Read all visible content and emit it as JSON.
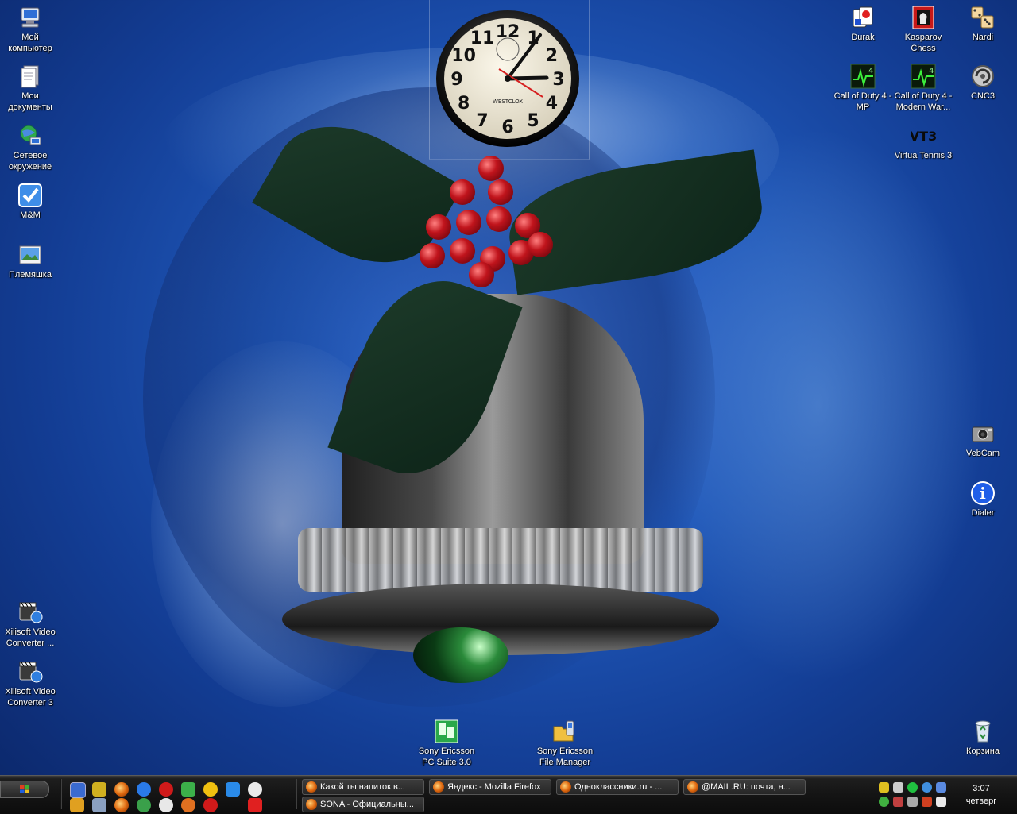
{
  "desktop": {
    "left_icons": [
      {
        "label": "Мой компьютер",
        "icon": "my-computer-icon"
      },
      {
        "label": "Мои документы",
        "icon": "my-documents-icon"
      },
      {
        "label": "Сетевое окружение",
        "icon": "network-places-icon"
      },
      {
        "label": "M&M",
        "icon": "checkmark-app-icon"
      },
      {
        "label": "Племяшка",
        "icon": "picture-icon"
      },
      {
        "label": "Xilisoft Video Converter ...",
        "icon": "video-converter-icon"
      },
      {
        "label": "Xilisoft Video Converter 3",
        "icon": "video-converter-icon"
      }
    ],
    "right_icons": [
      {
        "label": "Durak",
        "icon": "cards-game-icon"
      },
      {
        "label": "Kasparov Chess",
        "icon": "chess-icon"
      },
      {
        "label": "Nardi",
        "icon": "dice-icon"
      },
      {
        "label": "Call of Duty 4 - MP",
        "icon": "cod4-icon"
      },
      {
        "label": "Call of Duty 4 - Modern War...",
        "icon": "cod4-icon"
      },
      {
        "label": "CNC3",
        "icon": "cnc3-icon"
      },
      {
        "label": "Virtua Tennis 3",
        "icon": "vt3-icon",
        "glyph_text": "VT3"
      },
      {
        "label": "VebCam",
        "icon": "webcam-icon"
      },
      {
        "label": "Dialer",
        "icon": "info-icon",
        "glyph_text": "i"
      },
      {
        "label": "Корзина",
        "icon": "recycle-bin-icon"
      }
    ],
    "bottom_icons": [
      {
        "label": "Sony Ericsson PC Suite 3.0",
        "icon": "pc-suite-icon"
      },
      {
        "label": "Sony Ericsson File Manager",
        "icon": "file-manager-icon"
      }
    ]
  },
  "clock_gadget": {
    "brand": "WESTCLOX",
    "numerals": [
      "12",
      "1",
      "2",
      "3",
      "4",
      "5",
      "6",
      "7",
      "8",
      "9",
      "10",
      "11"
    ],
    "time": "3:07"
  },
  "taskbar": {
    "start_icon": "windows-flag-icon",
    "quick_launch": [
      "show-desktop-icon",
      "network-icon",
      "firefox-icon",
      "ie-icon",
      "opera-icon",
      "messenger-icon",
      "smiley-icon",
      "mail-icon",
      "media-icon",
      "tool-icon",
      "box-icon",
      "firefox-icon",
      "chrome-icon",
      "pacman-icon",
      "media-player-icon",
      "opera-icon",
      "red-app-icon"
    ],
    "tasks": [
      {
        "title": "Какой ты напиток в...",
        "icon": "firefox-icon"
      },
      {
        "title": "Яндекс - Mozilla Firefox",
        "icon": "firefox-icon"
      },
      {
        "title": "Одноклассники.ru - ...",
        "icon": "firefox-icon"
      },
      {
        "title": "@MAIL.RU: почта, н...",
        "icon": "firefox-icon"
      },
      {
        "title": "SONA - Официальны...",
        "icon": "firefox-icon"
      }
    ],
    "tray": {
      "time": "3:07",
      "day": "четверг",
      "icons": [
        "shield-icon",
        "usb-icon",
        "icq-icon",
        "eye-icon",
        "network-tray-icon",
        "user-icon",
        "monitor-icon",
        "device-icon",
        "volume-icon",
        "antivirus-icon"
      ]
    }
  }
}
